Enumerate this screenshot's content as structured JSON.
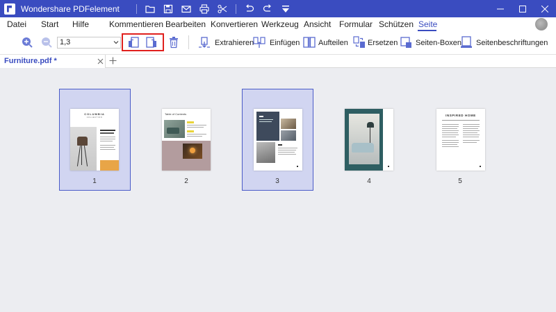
{
  "titlebar": {
    "app_title": "Wondershare PDFelement",
    "icons": [
      "folder-icon",
      "save-icon",
      "mail-icon",
      "print-icon",
      "scissors-icon",
      "undo-icon",
      "redo-icon",
      "dropdown-icon"
    ],
    "window_controls": [
      "minimize-icon",
      "maximize-icon",
      "close-icon"
    ]
  },
  "menu": {
    "items": [
      "Datei",
      "Start",
      "Hilfe",
      "Kommentieren",
      "Bearbeiten",
      "Konvertieren",
      "Werkzeug",
      "Ansicht",
      "Formular",
      "Schützen",
      "Seite"
    ],
    "active": "Seite"
  },
  "toolbar": {
    "page_range": "1,3",
    "tools": [
      {
        "label": "Extrahieren",
        "icon": "extract-icon"
      },
      {
        "label": "Einfügen",
        "icon": "insert-icon"
      },
      {
        "label": "Aufteilen",
        "icon": "split-icon"
      },
      {
        "label": "Ersetzen",
        "icon": "replace-icon"
      },
      {
        "label": "Seiten-Boxen",
        "icon": "page-boxes-icon"
      },
      {
        "label": "Seitenbeschriftungen",
        "icon": "page-labels-icon"
      }
    ],
    "highlight_color": "#e0201d"
  },
  "tabs": {
    "document": "Furniture.pdf *"
  },
  "pages": [
    {
      "number": "1",
      "selected": true,
      "title": "COLUMBIA",
      "subtitle": "COLLECTION"
    },
    {
      "number": "2",
      "selected": false,
      "title": "Table of Contents"
    },
    {
      "number": "3",
      "selected": true
    },
    {
      "number": "4",
      "selected": false
    },
    {
      "number": "5",
      "selected": false,
      "title": "INSPIRED HOME"
    }
  ],
  "colors": {
    "brand": "#3a4cc0",
    "selection_fill": "#d1d5f1",
    "background": "#ecedf1"
  }
}
